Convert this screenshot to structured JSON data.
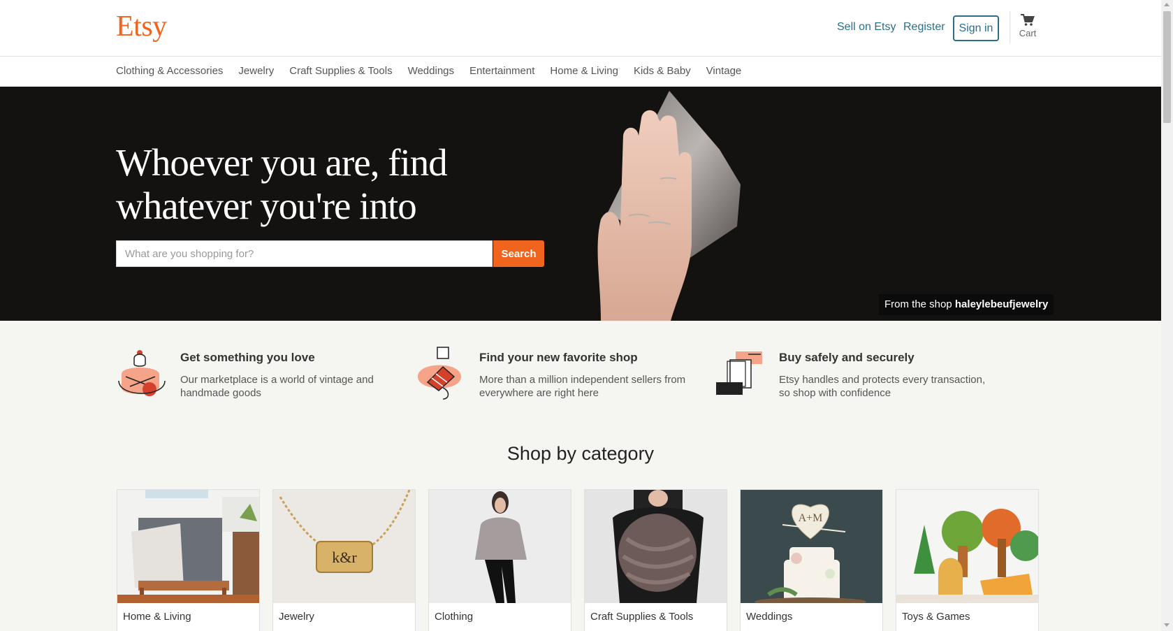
{
  "header": {
    "logo": "Etsy",
    "sell": "Sell on Etsy",
    "register": "Register",
    "signin": "Sign in",
    "cart": "Cart"
  },
  "nav": {
    "items": [
      "Clothing & Accessories",
      "Jewelry",
      "Craft Supplies & Tools",
      "Weddings",
      "Entertainment",
      "Home & Living",
      "Kids & Baby",
      "Vintage"
    ]
  },
  "hero": {
    "headline_line1": "Whoever you are, find",
    "headline_line2": "whatever you're into",
    "search_placeholder": "What are you shopping for?",
    "search_button": "Search",
    "credit_prefix": "From the shop",
    "credit_shop": "haleylebeufjewelry"
  },
  "props": [
    {
      "title": "Get something you love",
      "desc": "Our marketplace is a world of vintage and handmade goods"
    },
    {
      "title": "Find your new favorite shop",
      "desc": "More than a million independent sellers from everywhere are right here"
    },
    {
      "title": "Buy safely and securely",
      "desc": "Etsy handles and protects every transaction, so shop with confidence"
    }
  ],
  "section_title": "Shop by category",
  "categories": [
    "Home & Living",
    "Jewelry",
    "Clothing",
    "Craft Supplies & Tools",
    "Weddings",
    "Toys & Games"
  ],
  "colors": {
    "brand": "#f1641e",
    "link": "#2a6f8a",
    "hero_bg": "#141211",
    "page_bg": "#f5f5f1"
  },
  "icons": [
    "cart-icon",
    "love-illustration-icon",
    "shop-illustration-icon",
    "secure-illustration-icon"
  ]
}
